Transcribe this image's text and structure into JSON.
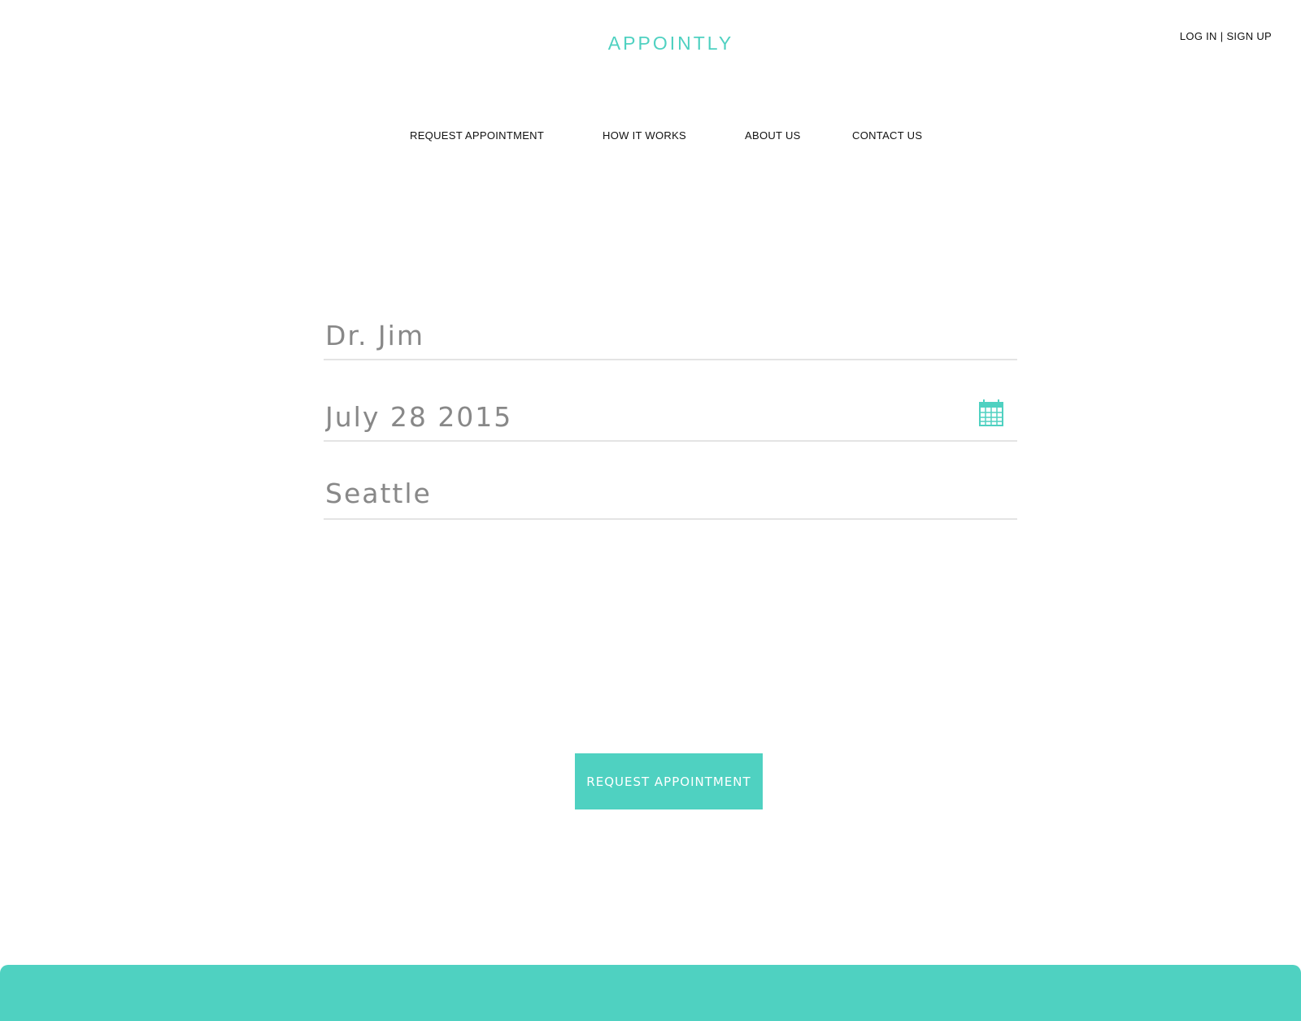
{
  "brand": {
    "name": "APPOINTLY",
    "color": "#4fd1c1"
  },
  "auth": {
    "login_label": "LOG IN",
    "separator": "|",
    "signup_label": "SIGN UP"
  },
  "nav": {
    "items": [
      {
        "label": "REQUEST APPOINTMENT"
      },
      {
        "label": "HOW IT WORKS"
      },
      {
        "label": "ABOUT US"
      },
      {
        "label": "CONTACT US"
      }
    ]
  },
  "form": {
    "doctor": {
      "value": "Dr. Jim"
    },
    "date": {
      "value": "July 28 2015",
      "icon": "calendar-icon"
    },
    "location": {
      "value": "Seattle"
    },
    "submit_label": "REQUEST APPOINTMENT"
  }
}
